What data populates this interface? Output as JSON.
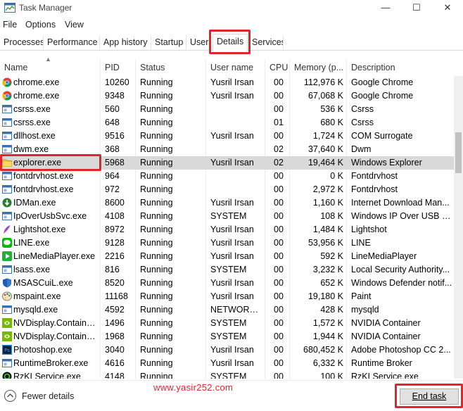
{
  "window": {
    "title": "Task Manager",
    "minimize": "—",
    "maximize": "☐",
    "close": "✕"
  },
  "menu": [
    "File",
    "Options",
    "View"
  ],
  "tabs": [
    "Processes",
    "Performance",
    "App history",
    "Startup",
    "Users",
    "Details",
    "Services"
  ],
  "active_tab": "Details",
  "columns": [
    "Name",
    "PID",
    "Status",
    "User name",
    "CPU",
    "Memory (p...",
    "Description"
  ],
  "rows": [
    {
      "name": "chrome.exe",
      "pid": "10260",
      "status": "Running",
      "user": "Yusril Irsan",
      "cpu": "00",
      "mem": "112,976 K",
      "desc": "Google Chrome",
      "icon": "chrome-icon"
    },
    {
      "name": "chrome.exe",
      "pid": "9348",
      "status": "Running",
      "user": "Yusril Irsan",
      "cpu": "00",
      "mem": "67,068 K",
      "desc": "Google Chrome",
      "icon": "chrome-icon"
    },
    {
      "name": "csrss.exe",
      "pid": "560",
      "status": "Running",
      "user": "",
      "cpu": "00",
      "mem": "536 K",
      "desc": "Csrss",
      "icon": "window-icon"
    },
    {
      "name": "csrss.exe",
      "pid": "648",
      "status": "Running",
      "user": "",
      "cpu": "01",
      "mem": "680 K",
      "desc": "Csrss",
      "icon": "window-icon"
    },
    {
      "name": "dllhost.exe",
      "pid": "9516",
      "status": "Running",
      "user": "Yusril Irsan",
      "cpu": "00",
      "mem": "1,724 K",
      "desc": "COM Surrogate",
      "icon": "window-icon"
    },
    {
      "name": "dwm.exe",
      "pid": "368",
      "status": "Running",
      "user": "",
      "cpu": "02",
      "mem": "37,640 K",
      "desc": "Dwm",
      "icon": "window-icon"
    },
    {
      "name": "explorer.exe",
      "pid": "5968",
      "status": "Running",
      "user": "Yusril Irsan",
      "cpu": "02",
      "mem": "19,464 K",
      "desc": "Windows Explorer",
      "icon": "folder-icon",
      "selected": true
    },
    {
      "name": "fontdrvhost.exe",
      "pid": "964",
      "status": "Running",
      "user": "",
      "cpu": "00",
      "mem": "0 K",
      "desc": "Fontdrvhost",
      "icon": "window-icon"
    },
    {
      "name": "fontdrvhost.exe",
      "pid": "972",
      "status": "Running",
      "user": "",
      "cpu": "00",
      "mem": "2,972 K",
      "desc": "Fontdrvhost",
      "icon": "window-icon"
    },
    {
      "name": "IDMan.exe",
      "pid": "8600",
      "status": "Running",
      "user": "Yusril Irsan",
      "cpu": "00",
      "mem": "1,160 K",
      "desc": "Internet Download Man...",
      "icon": "idm-icon"
    },
    {
      "name": "IpOverUsbSvc.exe",
      "pid": "4108",
      "status": "Running",
      "user": "SYSTEM",
      "cpu": "00",
      "mem": "108 K",
      "desc": "Windows IP Over USB P...",
      "icon": "window-icon"
    },
    {
      "name": "Lightshot.exe",
      "pid": "8972",
      "status": "Running",
      "user": "Yusril Irsan",
      "cpu": "00",
      "mem": "1,484 K",
      "desc": "Lightshot",
      "icon": "feather-icon"
    },
    {
      "name": "LINE.exe",
      "pid": "9128",
      "status": "Running",
      "user": "Yusril Irsan",
      "cpu": "00",
      "mem": "53,956 K",
      "desc": "LINE",
      "icon": "line-icon"
    },
    {
      "name": "LineMediaPlayer.exe",
      "pid": "2216",
      "status": "Running",
      "user": "Yusril Irsan",
      "cpu": "00",
      "mem": "592 K",
      "desc": "LineMediaPlayer",
      "icon": "play-icon"
    },
    {
      "name": "lsass.exe",
      "pid": "816",
      "status": "Running",
      "user": "SYSTEM",
      "cpu": "00",
      "mem": "3,232 K",
      "desc": "Local Security Authority...",
      "icon": "window-icon"
    },
    {
      "name": "MSASCuiL.exe",
      "pid": "8520",
      "status": "Running",
      "user": "Yusril Irsan",
      "cpu": "00",
      "mem": "652 K",
      "desc": "Windows Defender notif...",
      "icon": "shield-icon"
    },
    {
      "name": "mspaint.exe",
      "pid": "11168",
      "status": "Running",
      "user": "Yusril Irsan",
      "cpu": "00",
      "mem": "19,180 K",
      "desc": "Paint",
      "icon": "palette-icon"
    },
    {
      "name": "mysqld.exe",
      "pid": "4592",
      "status": "Running",
      "user": "NETWORK...",
      "cpu": "00",
      "mem": "428 K",
      "desc": "mysqld",
      "icon": "window-icon"
    },
    {
      "name": "NVDisplay.Container...",
      "pid": "1496",
      "status": "Running",
      "user": "SYSTEM",
      "cpu": "00",
      "mem": "1,572 K",
      "desc": "NVIDIA Container",
      "icon": "nvidia-icon"
    },
    {
      "name": "NVDisplay.Container...",
      "pid": "1968",
      "status": "Running",
      "user": "SYSTEM",
      "cpu": "00",
      "mem": "1,944 K",
      "desc": "NVIDIA Container",
      "icon": "nvidia-icon"
    },
    {
      "name": "Photoshop.exe",
      "pid": "3040",
      "status": "Running",
      "user": "Yusril Irsan",
      "cpu": "00",
      "mem": "680,452 K",
      "desc": "Adobe Photoshop CC 2...",
      "icon": "photoshop-icon"
    },
    {
      "name": "RuntimeBroker.exe",
      "pid": "4616",
      "status": "Running",
      "user": "Yusril Irsan",
      "cpu": "00",
      "mem": "6,332 K",
      "desc": "Runtime Broker",
      "icon": "window-icon"
    },
    {
      "name": "RzKLService.exe",
      "pid": "4148",
      "status": "Running",
      "user": "SYSTEM",
      "cpu": "00",
      "mem": "100 K",
      "desc": "RzKLService.exe",
      "icon": "razer-icon"
    }
  ],
  "footer": {
    "fewer_details": "Fewer details",
    "watermark": "www.yasir252.com",
    "end_task": "End task"
  }
}
